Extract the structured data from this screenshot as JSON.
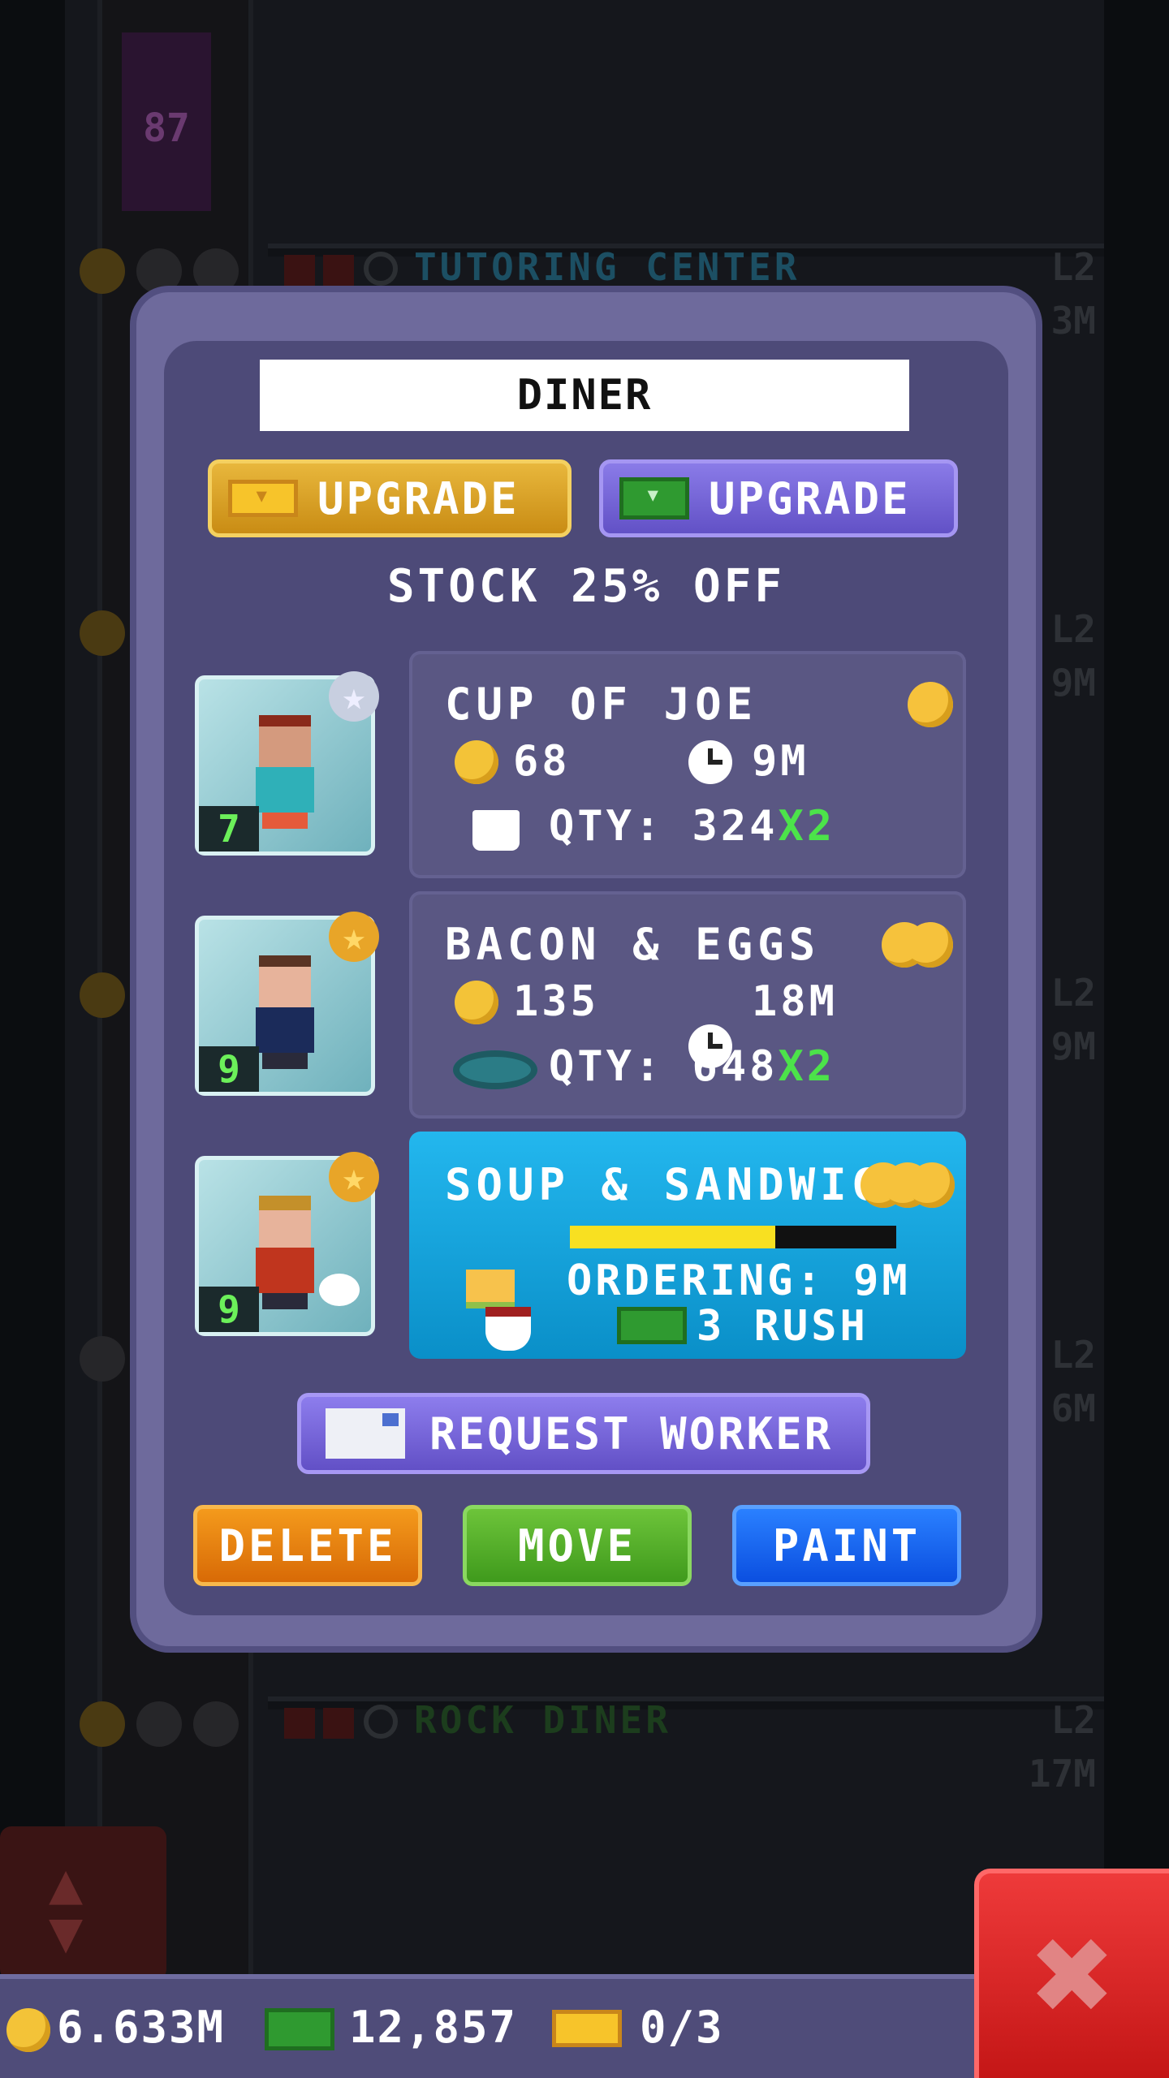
{
  "background": {
    "floor_number": "87",
    "floors": [
      {
        "name": "TUTORING CENTER",
        "level": "L2",
        "level_sub": "3M",
        "color": "#1c4f63"
      },
      {
        "name": "ROCK DINER",
        "level": "L2",
        "level_sub": "17M",
        "color": "#1c3d1d"
      }
    ],
    "side_levels": [
      "L2",
      "L2",
      "L2"
    ],
    "side_sub": [
      "9M",
      "9M",
      "6M"
    ]
  },
  "modal": {
    "title": "DINER",
    "upgrade_gold_label": "UPGRADE",
    "upgrade_cash_label": "UPGRADE",
    "stock_text": "STOCK 25% OFF",
    "products": [
      {
        "name": "CUP OF JOE",
        "price": "68",
        "time": "9M",
        "qty_label": "QTY: 324",
        "multiplier": "X2",
        "tier": 1,
        "worker_level": "7",
        "worker_star": "silver"
      },
      {
        "name": "BACON & EGGS",
        "price": "135",
        "time": "18M",
        "qty_label": "QTY: 648",
        "multiplier": "X2",
        "tier": 2,
        "worker_level": "9",
        "worker_star": "gold"
      },
      {
        "name": "SOUP & SANDWIC",
        "status": "ORDERING: 9M",
        "rush_label": "3 RUSH",
        "progress": 0.63,
        "tier": 3,
        "worker_level": "9",
        "worker_star": "gold"
      }
    ],
    "request_worker_label": "REQUEST WORKER",
    "delete_label": "DELETE",
    "move_label": "MOVE",
    "paint_label": "PAINT"
  },
  "bottom_bar": {
    "coins": "6.633M",
    "bux": "12,857",
    "tickets": "0/3"
  },
  "close_icon": "✖",
  "colors": {
    "gold": "#e8b73c",
    "purple": "#6251c6",
    "active_row": "#23b7ee",
    "multiplier": "#4ce34a",
    "progress": "#f8e021"
  }
}
